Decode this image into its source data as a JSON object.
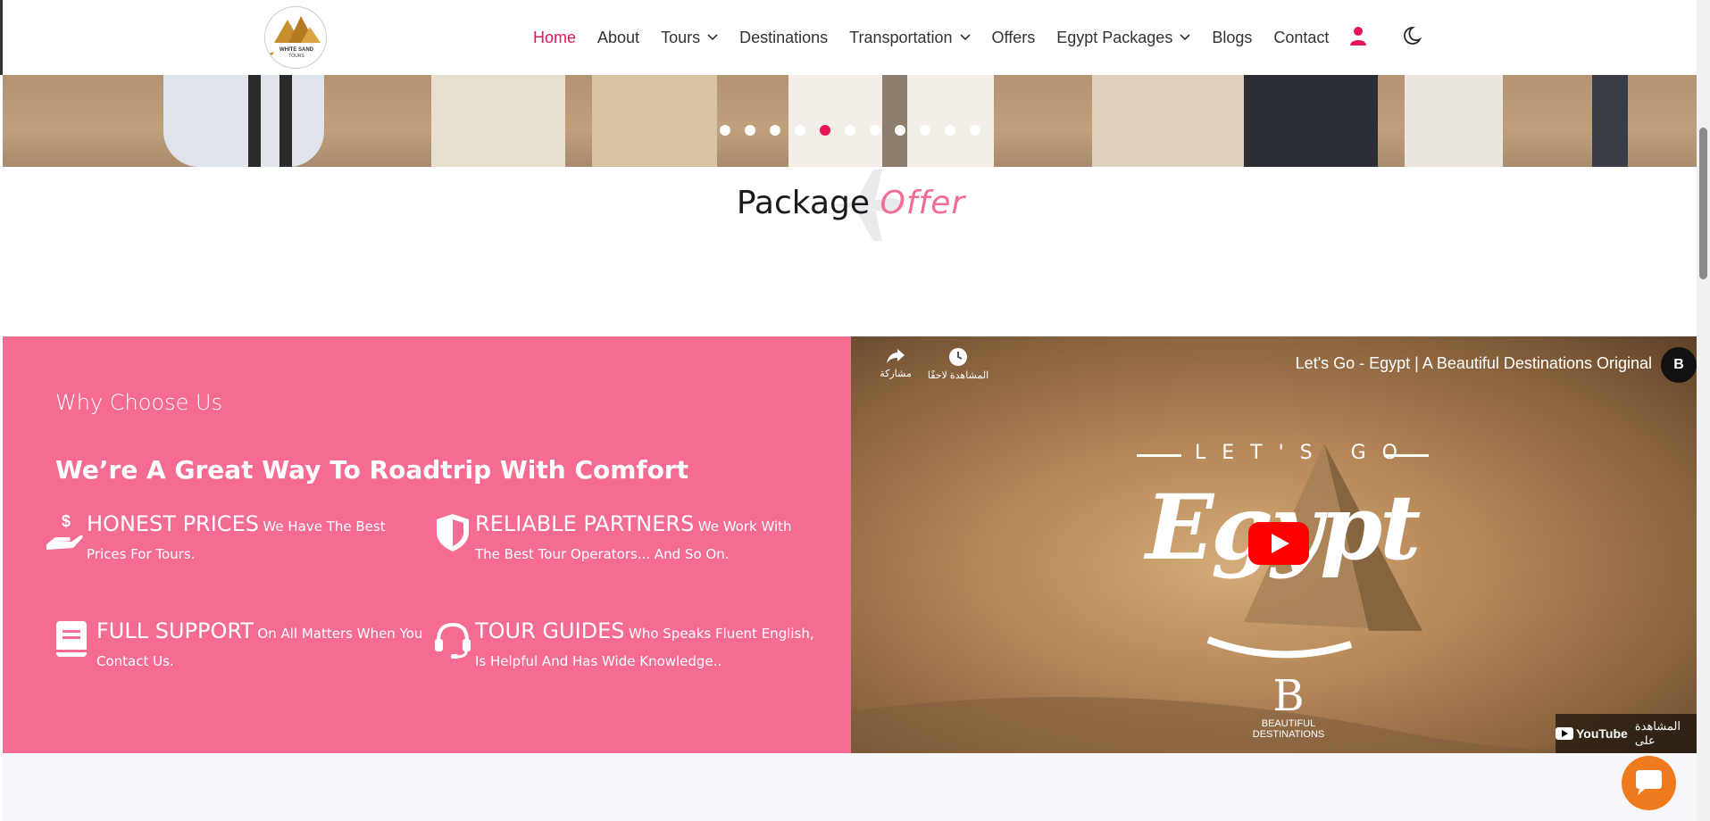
{
  "nav": {
    "brand_alt": "White Sand Tours",
    "logo_text_1": "WHITE SAND",
    "logo_text_2": "TOURS",
    "items": [
      {
        "label": "Home",
        "active": true,
        "dropdown": false
      },
      {
        "label": "About",
        "active": false,
        "dropdown": false
      },
      {
        "label": "Tours",
        "active": false,
        "dropdown": true
      },
      {
        "label": "Destinations",
        "active": false,
        "dropdown": false
      },
      {
        "label": "Transportation",
        "active": false,
        "dropdown": true
      },
      {
        "label": "Offers",
        "active": false,
        "dropdown": false
      },
      {
        "label": "Egypt Packages",
        "active": false,
        "dropdown": true
      },
      {
        "label": "Blogs",
        "active": false,
        "dropdown": false
      },
      {
        "label": "Contact",
        "active": false,
        "dropdown": false
      }
    ],
    "user_icon": "user-icon",
    "theme_icon": "moon-icon"
  },
  "slider": {
    "dot_count": 11,
    "active_index": 4
  },
  "package": {
    "title_main": "Package",
    "title_accent": "Offer"
  },
  "why": {
    "eyebrow": "Why Choose Us",
    "heading": "We’re A Great Way To Roadtrip With Comfort",
    "features": [
      {
        "title": "HONEST PRICES",
        "desc": "We Have The Best Prices For Tours.",
        "icon": "hand-dollar-icon"
      },
      {
        "title": "RELIABLE PARTNERS",
        "desc": "We Work With The Best Tour Operators... And So On.",
        "icon": "shield-icon"
      },
      {
        "title": "FULL SUPPORT",
        "desc": "On All Matters When You Contact Us.",
        "icon": "book-icon"
      },
      {
        "title": "TOUR GUIDES",
        "desc": "Who Speaks Fluent English, Is Helpful And Has Wide Knowledge..",
        "icon": "headset-icon"
      }
    ]
  },
  "video": {
    "title": "Let's Go - Egypt | A Beautiful Destinations Original",
    "channel_initial": "B",
    "share_label": "مشاركة",
    "watch_later_label": "المشاهدة لاحقًا",
    "overlay_top": "LET'S GO",
    "overlay_main": "Egypt",
    "brand_mark": "B",
    "brand_line1": "BEAUTIFUL",
    "brand_line2": "DESTINATIONS",
    "watch_on": "المشاهدة على",
    "youtube": "YouTube"
  },
  "colors": {
    "accent": "#e6155a",
    "pink_panel": "#f66b91",
    "chat": "#f07a1e"
  }
}
